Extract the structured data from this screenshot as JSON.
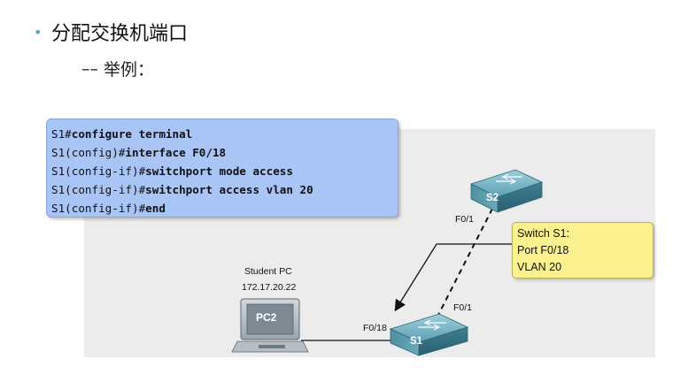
{
  "slide": {
    "bullet": "•",
    "title": "分配交换机端口",
    "sub_dash": "––",
    "subtitle": "举例："
  },
  "code": {
    "lines": [
      {
        "prompt": "S1#",
        "cmd": "configure terminal"
      },
      {
        "prompt": "S1(config)#",
        "cmd": "interface F0/18"
      },
      {
        "prompt": "S1(config-if)#",
        "cmd": "switchport mode access"
      },
      {
        "prompt": "S1(config-if)#",
        "cmd": "switchport access vlan 20"
      },
      {
        "prompt": "S1(config-if)#",
        "cmd": "end"
      }
    ]
  },
  "callout": {
    "line1": "Switch S1:",
    "line2": "Port F0/18",
    "line3": "VLAN 20"
  },
  "diagram": {
    "s2_label": "S2",
    "s1_label": "S1",
    "pc_label": "PC2",
    "pc_name": "Student PC",
    "pc_ip": "172.17.20.22",
    "s2_port": "F0/1",
    "s1_port_uplink": "F0/1",
    "s1_port_pc": "F0/18"
  },
  "colors": {
    "code_bg": "#a9c5f6",
    "callout_bg": "#fbf28f",
    "switch": "#4a8fa3",
    "bullet": "#58a6c9"
  }
}
